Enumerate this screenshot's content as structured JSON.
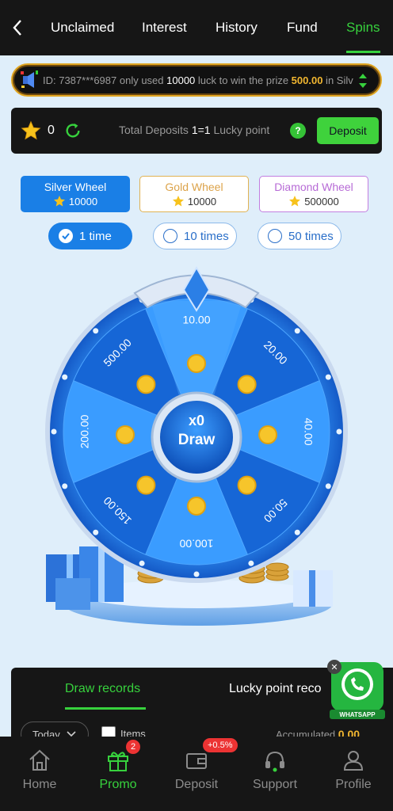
{
  "topnav": {
    "back_icon": "chevron-left-icon",
    "tabs": [
      {
        "label": "Unclaimed",
        "active": false
      },
      {
        "label": "Interest",
        "active": false
      },
      {
        "label": "History",
        "active": false
      },
      {
        "label": "Fund",
        "active": false
      },
      {
        "label": "Spins",
        "active": true
      }
    ]
  },
  "ticker": {
    "prefix": "ID: 7387***6987 only used ",
    "luck_amount": "10000",
    "mid": " luck to win the prize ",
    "prize": "500.00",
    "suffix": " in Silv"
  },
  "starbar": {
    "star_count": "0",
    "info_prefix": "Total Deposits ",
    "ratio": "1=1",
    "info_suffix": " Lucky point",
    "help_label": "?",
    "deposit_label": "Deposit"
  },
  "wheels": [
    {
      "name": "Silver Wheel",
      "cost": "10000",
      "active": true
    },
    {
      "name": "Gold Wheel",
      "cost": "10000",
      "active": false
    },
    {
      "name": "Diamond Wheel",
      "cost": "500000",
      "active": false
    }
  ],
  "times": [
    {
      "label": "1 time",
      "active": true
    },
    {
      "label": "10 times",
      "active": false
    },
    {
      "label": "50 times",
      "active": false
    }
  ],
  "wheel": {
    "center_count": "x0",
    "center_label": "Draw",
    "prizes": [
      "10.00",
      "20.00",
      "40.00",
      "50.00",
      "100.00",
      "150.00",
      "200.00",
      "500.00"
    ]
  },
  "panel": {
    "tabs": [
      "Draw records",
      "Lucky point reco"
    ],
    "filter_label": "Today",
    "items_label": "Items",
    "accumulated_label": "Accumulated",
    "accumulated_value": "0.00"
  },
  "whatsapp": {
    "label": "WHATSAPP",
    "close": "✕"
  },
  "bottomnav": [
    {
      "label": "Home",
      "icon": "home-icon",
      "active": false,
      "badge": ""
    },
    {
      "label": "Promo",
      "icon": "gift-icon",
      "active": true,
      "badge": "2"
    },
    {
      "label": "Deposit",
      "icon": "wallet-icon",
      "active": false,
      "badge": "+0.5%"
    },
    {
      "label": "Support",
      "icon": "headset-icon",
      "active": false,
      "badge": ""
    },
    {
      "label": "Profile",
      "icon": "user-icon",
      "active": false,
      "badge": ""
    }
  ],
  "colors": {
    "accent_green": "#37d13d",
    "primary_blue": "#1a7fe6",
    "gold": "#f1b630"
  }
}
